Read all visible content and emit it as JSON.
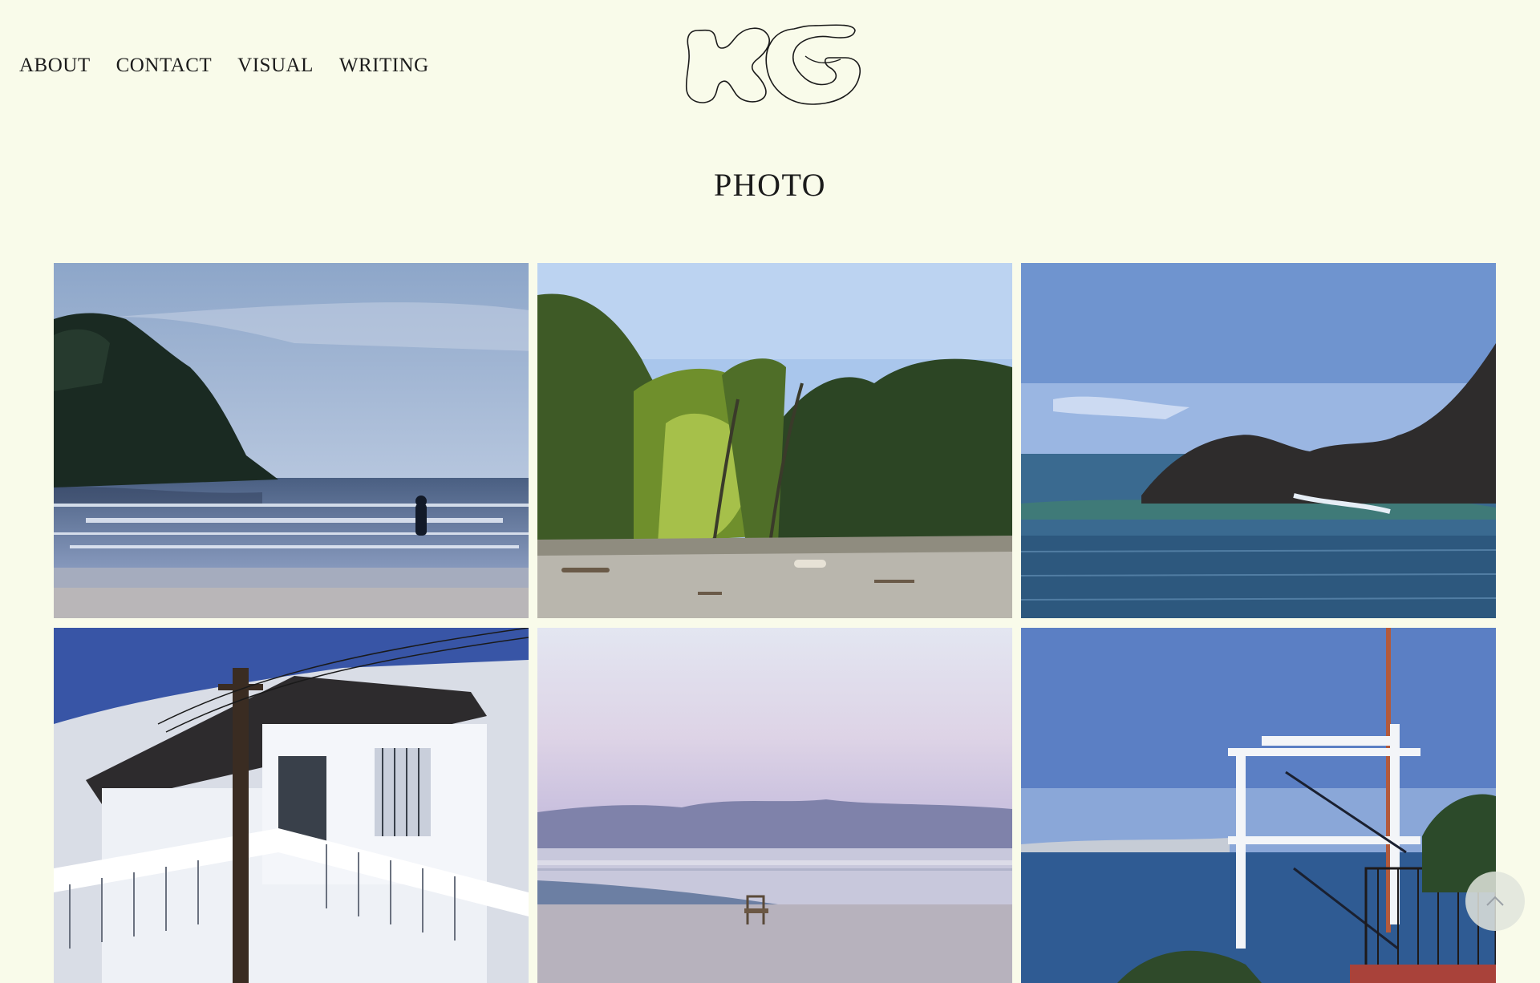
{
  "nav": {
    "items": [
      {
        "label": "ABOUT"
      },
      {
        "label": "CONTACT"
      },
      {
        "label": "VISUAL"
      },
      {
        "label": "WRITING"
      }
    ]
  },
  "logo": {
    "text": "KG",
    "icon": "kg-monogram-logo"
  },
  "page": {
    "title": "PHOTO"
  },
  "gallery": {
    "photos": [
      {
        "subject": "beach-island-swimmer"
      },
      {
        "subject": "palm-trees-beach"
      },
      {
        "subject": "rocks-waves"
      },
      {
        "subject": "white-house-balcony"
      },
      {
        "subject": "dusk-beach-chair"
      },
      {
        "subject": "lookout-tower"
      }
    ]
  },
  "controls": {
    "scroll_top_icon": "chevron-up-icon"
  },
  "colors": {
    "background": "#f9fbea",
    "text": "#1b1b1b"
  }
}
